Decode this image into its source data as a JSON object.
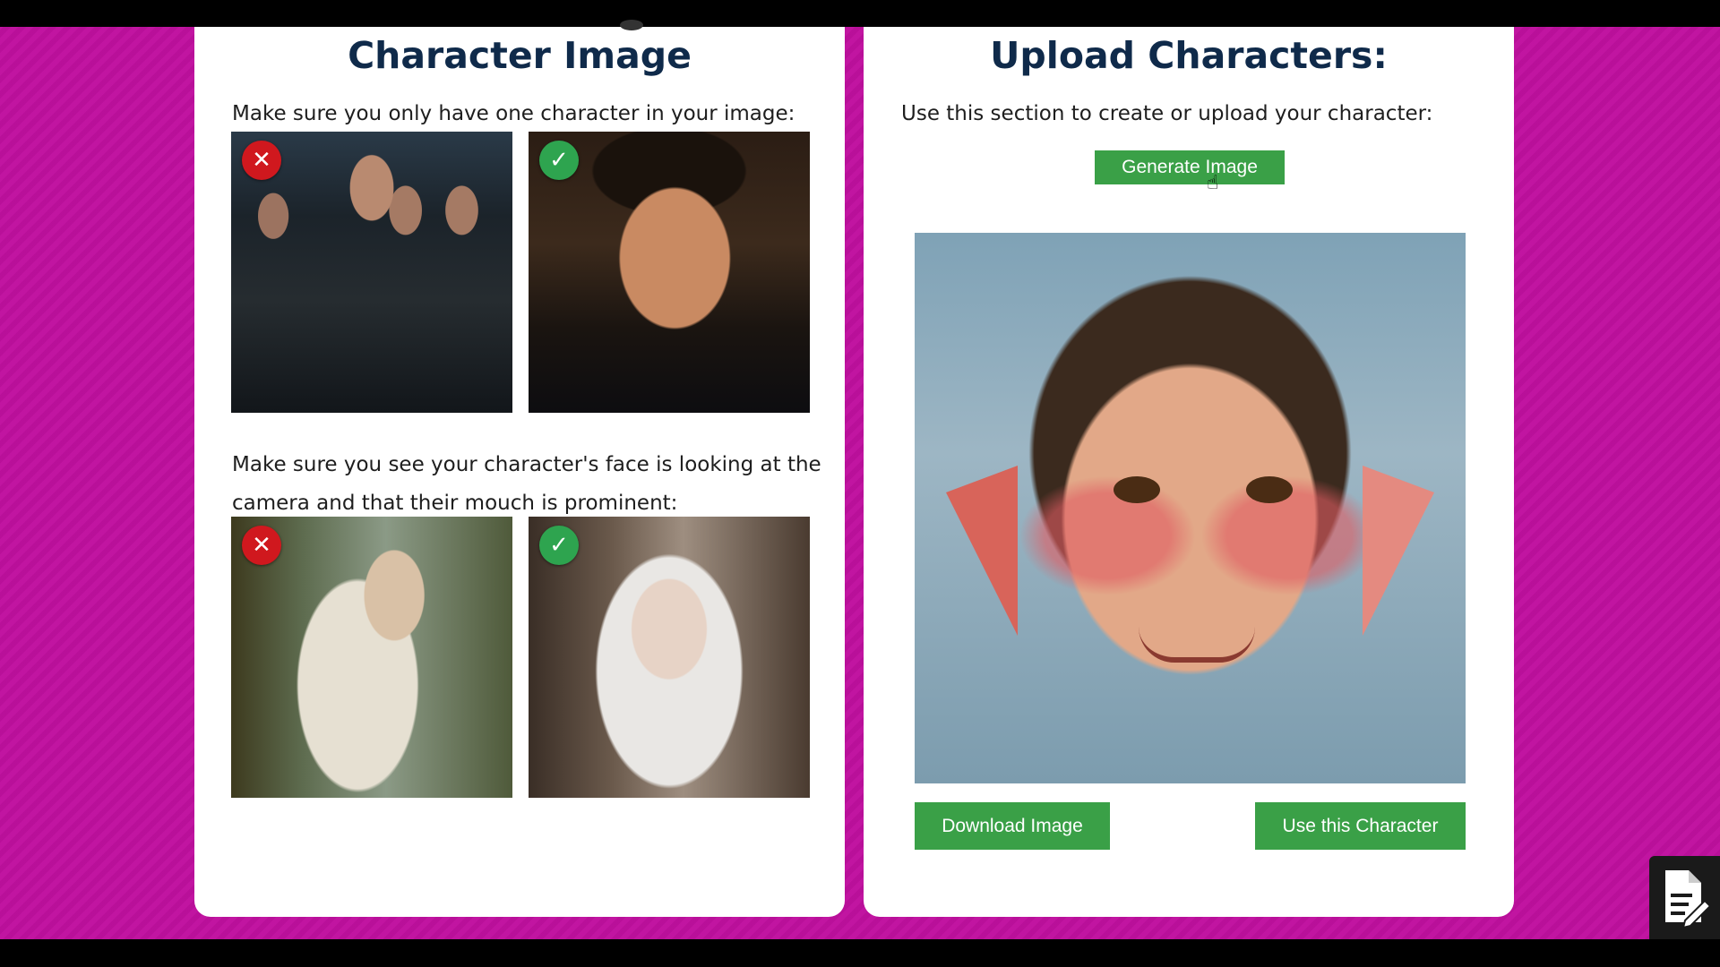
{
  "left_card": {
    "title": "Character Image",
    "instruction_one": "Make sure you only have one character in your image:",
    "instruction_two_line1": "Make sure you see your character's face is looking at the",
    "instruction_two_line2": "camera and that their mouch is prominent:",
    "examples": [
      {
        "status": "bad",
        "icon": "x-icon"
      },
      {
        "status": "good",
        "icon": "check-icon"
      },
      {
        "status": "bad",
        "icon": "x-icon"
      },
      {
        "status": "good",
        "icon": "check-icon"
      }
    ]
  },
  "right_card": {
    "title": "Upload Characters:",
    "instruction": "Use this section to create or upload your character:",
    "generate_label": "Generate Image",
    "download_label": "Download Image",
    "use_label": "Use this Character"
  },
  "colors": {
    "background": "#c0109f",
    "title": "#0f2a4a",
    "button": "#3aa047",
    "bad_badge": "#d0181e",
    "good_badge": "#2ea44f"
  }
}
